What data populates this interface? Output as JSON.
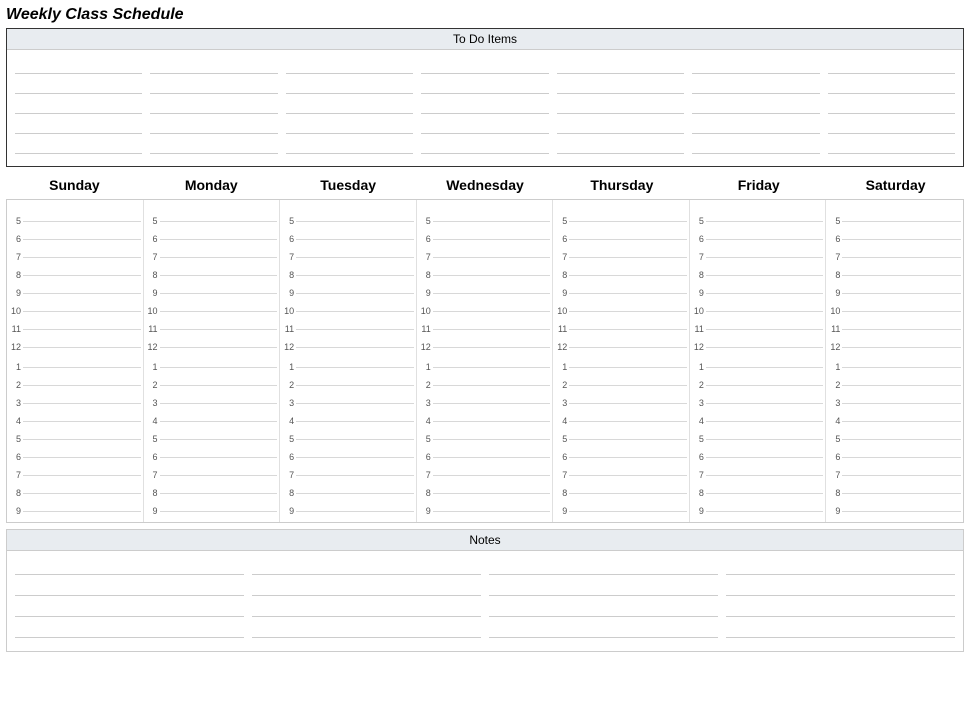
{
  "title": "Weekly Class Schedule",
  "todo": {
    "header": "To Do Items",
    "columns": 7,
    "lines_per_col": 5
  },
  "days": [
    "Sunday",
    "Monday",
    "Tuesday",
    "Wednesday",
    "Thursday",
    "Friday",
    "Saturday"
  ],
  "schedule": {
    "am_hours": [
      5,
      6,
      7,
      8,
      9,
      10,
      11,
      12
    ],
    "pm_hours": [
      1,
      2,
      3,
      4,
      5,
      6,
      7,
      8,
      9
    ]
  },
  "notes": {
    "header": "Notes",
    "columns": 4,
    "lines_per_col": 4
  }
}
